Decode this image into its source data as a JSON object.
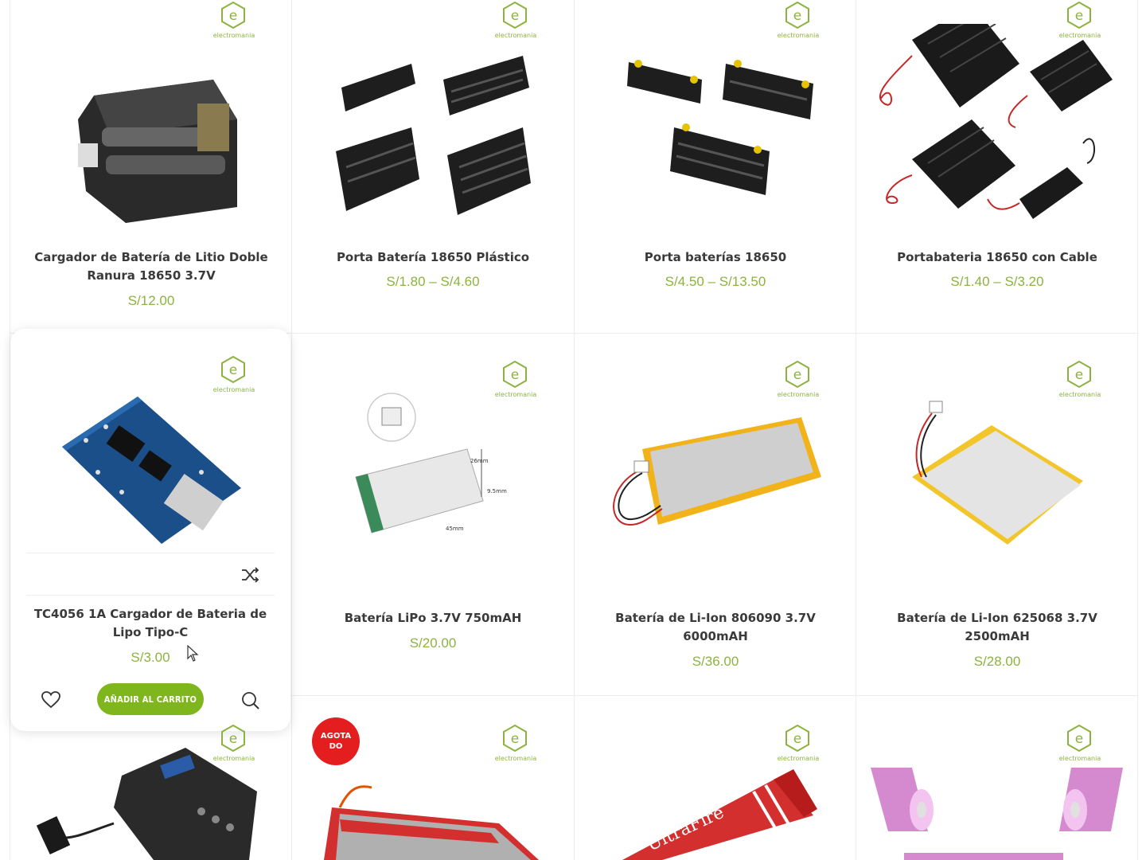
{
  "brand": {
    "prefix": "electro",
    "suffix": "mania",
    "color_green": "#8cb33f"
  },
  "colors": {
    "price": "#8cb33f",
    "button": "#7fb51d",
    "badge": "#e41e1e"
  },
  "products": [
    {
      "title": "Cargador de Batería de Litio Doble Ranura 18650 3.7V",
      "price": "S/12.00"
    },
    {
      "title": "Porta Batería 18650 Plástico",
      "price": "S/1.80 – S/4.60"
    },
    {
      "title": "Porta baterías 18650",
      "price": "S/4.50 – S/13.50"
    },
    {
      "title": "Portabateria 18650 con Cable",
      "price": "S/1.40 – S/3.20"
    },
    {
      "title": "TC4056 1A Cargador de Bateria de Lipo Tipo-C",
      "price": "S/3.00"
    },
    {
      "title": "Batería LiPo 3.7V 750mAH",
      "price": "S/20.00"
    },
    {
      "title": "Batería de Li-Ion 806090 3.7V 6000mAH",
      "price": "S/36.00"
    },
    {
      "title": "Batería de Li-Ion 625068 3.7V 2500mAH",
      "price": "S/28.00"
    }
  ],
  "hover_actions": {
    "add_to_cart": "AÑADIR AL CARRITO",
    "wishlist_icon": "heart-icon",
    "compare_icon": "shuffle-icon",
    "quickview_icon": "search-icon"
  },
  "badge": {
    "line1": "AGOTA",
    "line2": "DO"
  },
  "image_labels": {
    "dim_26": "26mm",
    "dim_9": "9.5mm",
    "dim_45": "45mm",
    "ultrafire": "UltraFire"
  }
}
